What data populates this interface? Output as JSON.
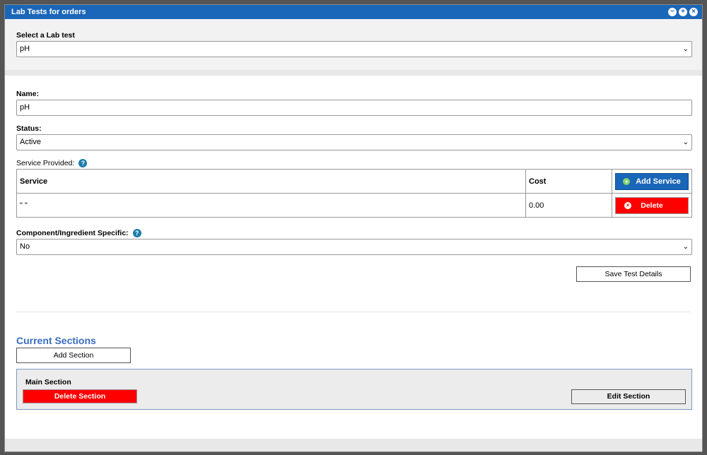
{
  "window": {
    "title": "Lab Tests for orders",
    "controls": [
      "minimize-icon",
      "maximize-icon",
      "close-icon"
    ]
  },
  "select_lab_test": {
    "label": "Select a Lab test",
    "value": "pH"
  },
  "name": {
    "label": "Name:",
    "value": "pH"
  },
  "status": {
    "label": "Status:",
    "value": "Active"
  },
  "service_provided": {
    "label": "Service Provided:",
    "columns": [
      "Service",
      "Cost"
    ],
    "add_button": "Add Service",
    "rows": [
      {
        "service": "\" \"",
        "cost": "0.00",
        "delete_button": "Delete"
      }
    ]
  },
  "component_specific": {
    "label": "Component/Ingredient Specific:",
    "value": "No"
  },
  "save_button": "Save Test Details",
  "sections": {
    "title": "Current Sections",
    "add_button": "Add Section",
    "items": [
      {
        "name": "Main Section",
        "delete_button": "Delete Section",
        "edit_button": "Edit Section"
      }
    ]
  },
  "colors": {
    "titlebar": "#1a66b8",
    "primary_button": "#1a66b8",
    "danger_button": "#ff0000",
    "section_title": "#3a6cc0",
    "help_icon": "#1b7ca8"
  }
}
